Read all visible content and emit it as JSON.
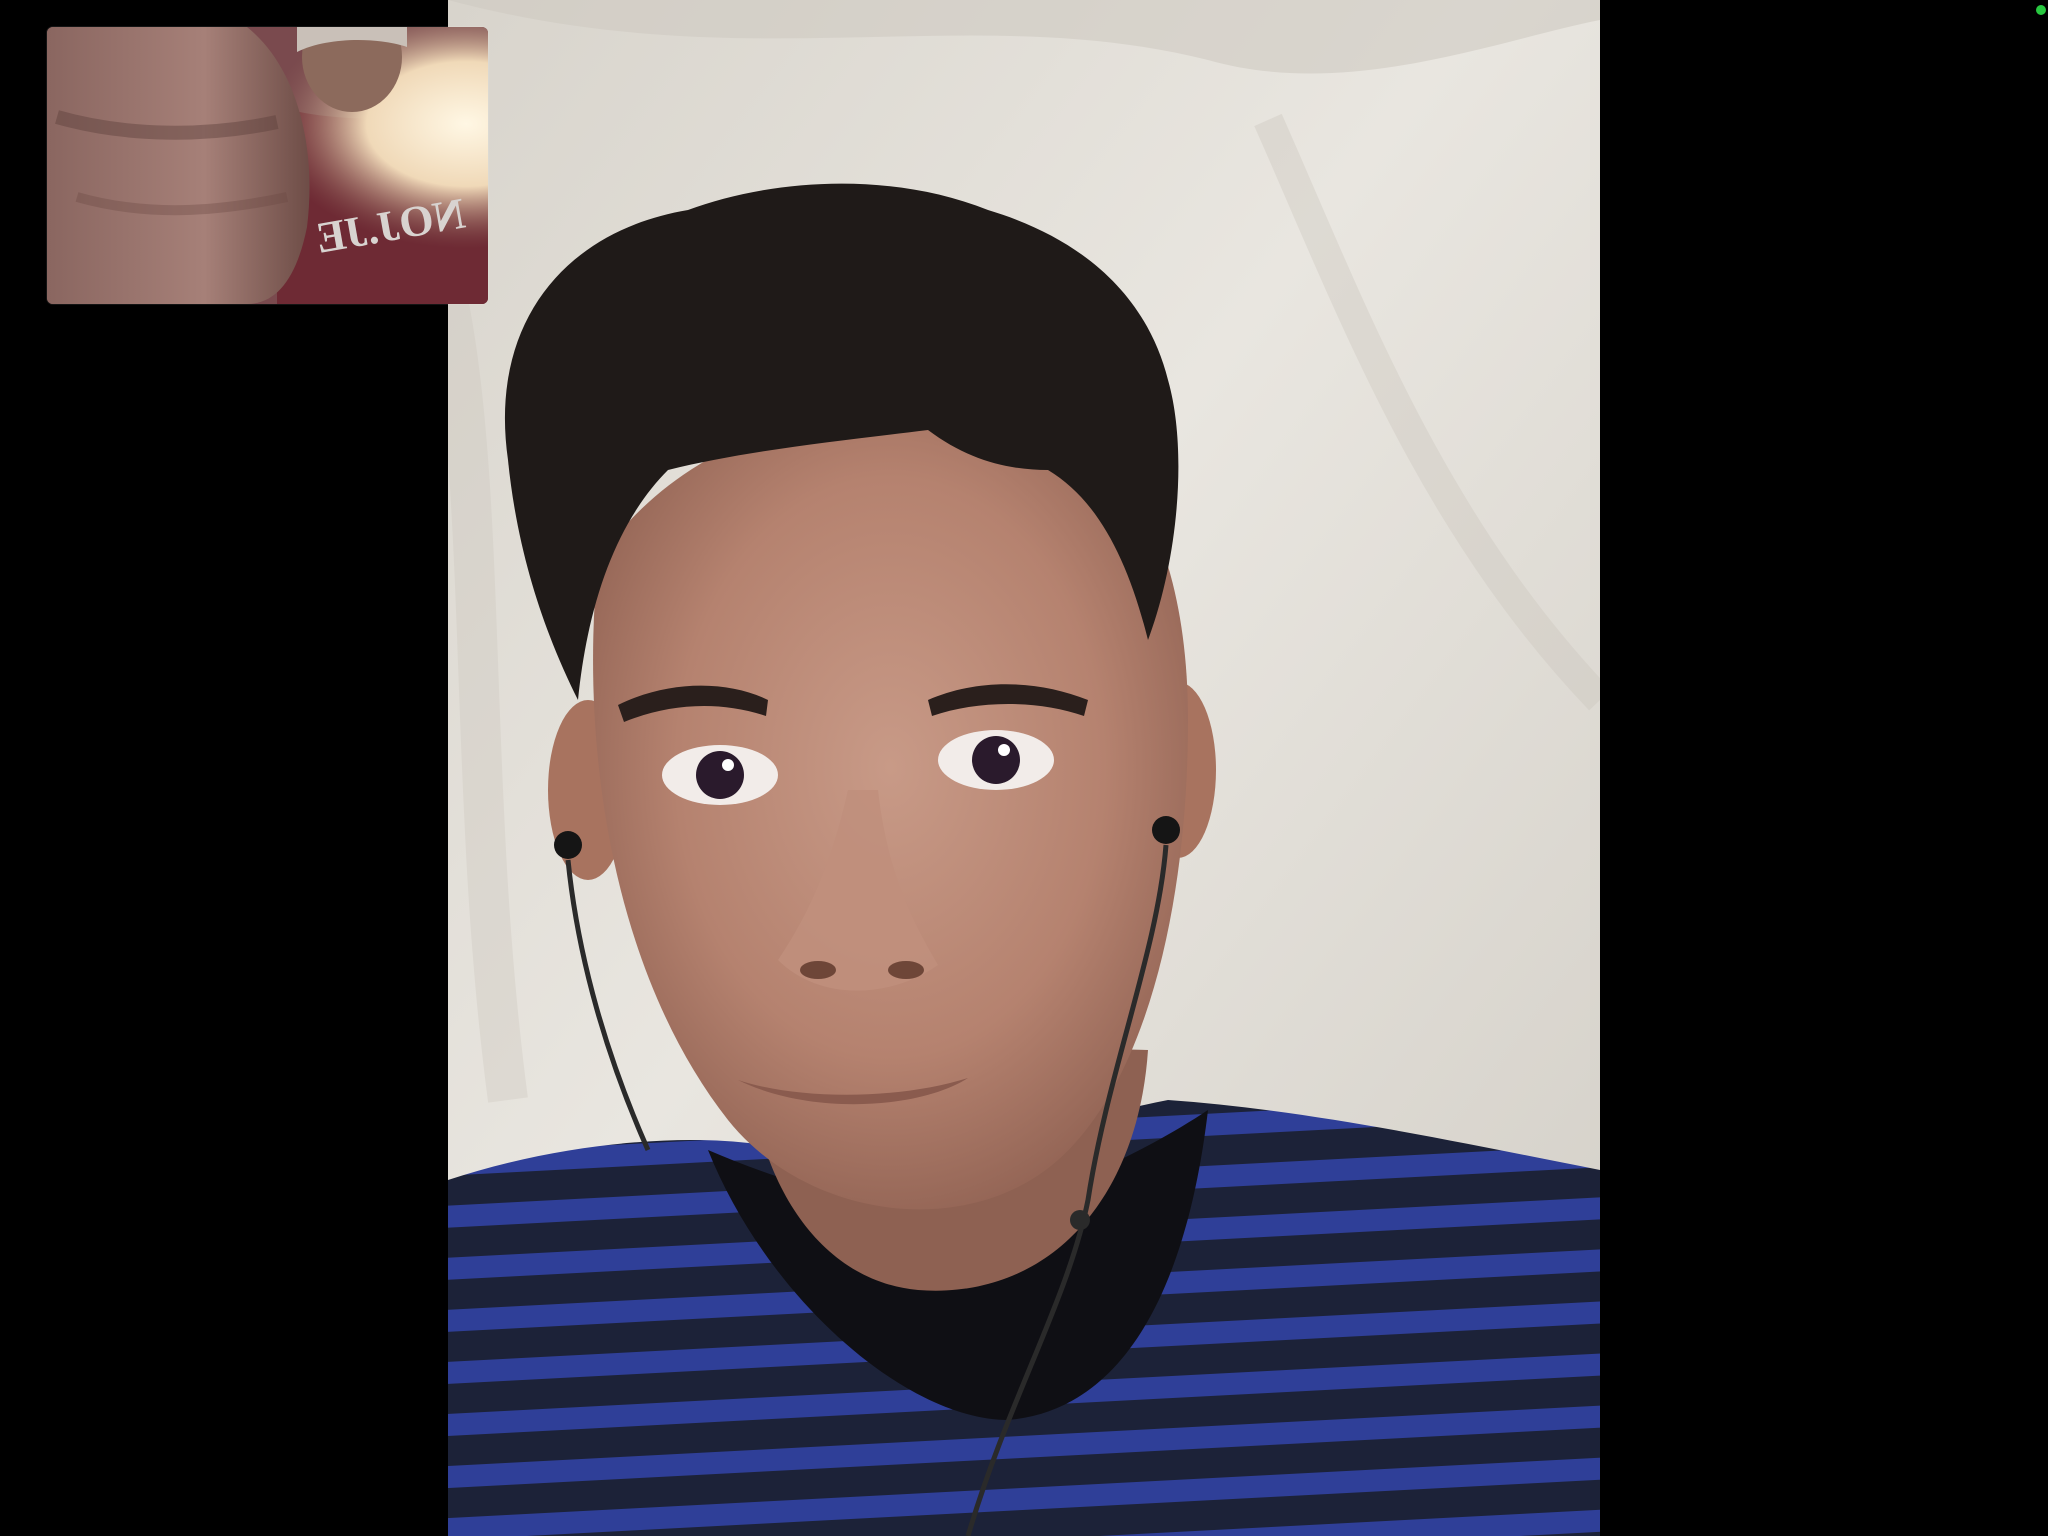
{
  "call": {
    "remote_participant_video": "remote-participant-feed",
    "self_preview_video": "self-preview-feed",
    "status_indicator_color": "#28c840"
  },
  "self_preview": {
    "shirt_lettering": "NOJ.JE"
  },
  "colors": {
    "background": "#000000",
    "wall": "#dedad2",
    "shirt_dark": "#1c2238",
    "shirt_stripe": "#2f3f98",
    "hair": "#1f1a18",
    "skin": "#b98572"
  }
}
